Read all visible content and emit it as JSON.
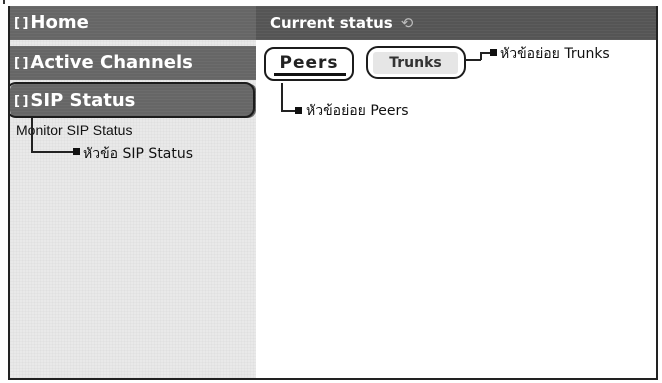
{
  "sidebar": {
    "items": [
      {
        "label": "Home",
        "icon": "expand-icon"
      },
      {
        "label": "Active Channels",
        "icon": "expand-icon"
      },
      {
        "label": "SIP Status",
        "icon": "expand-icon"
      }
    ],
    "submenu_link": "Monitor SIP Status"
  },
  "header": {
    "title": "Current status",
    "refresh_icon": "refresh-icon"
  },
  "tabs": [
    {
      "label": "Peers",
      "active": true
    },
    {
      "label": "Trunks",
      "active": false
    }
  ],
  "callouts": {
    "trunks": "หัวข้อย่อย Trunks",
    "peers": "หัวข้อย่อย Peers",
    "sip_status": "หัวข้อ SIP Status"
  },
  "colors": {
    "nav_background": "#666666",
    "header_background": "#555555",
    "sidebar_background": "#e9e9e9",
    "nav_text": "#ffffff"
  }
}
